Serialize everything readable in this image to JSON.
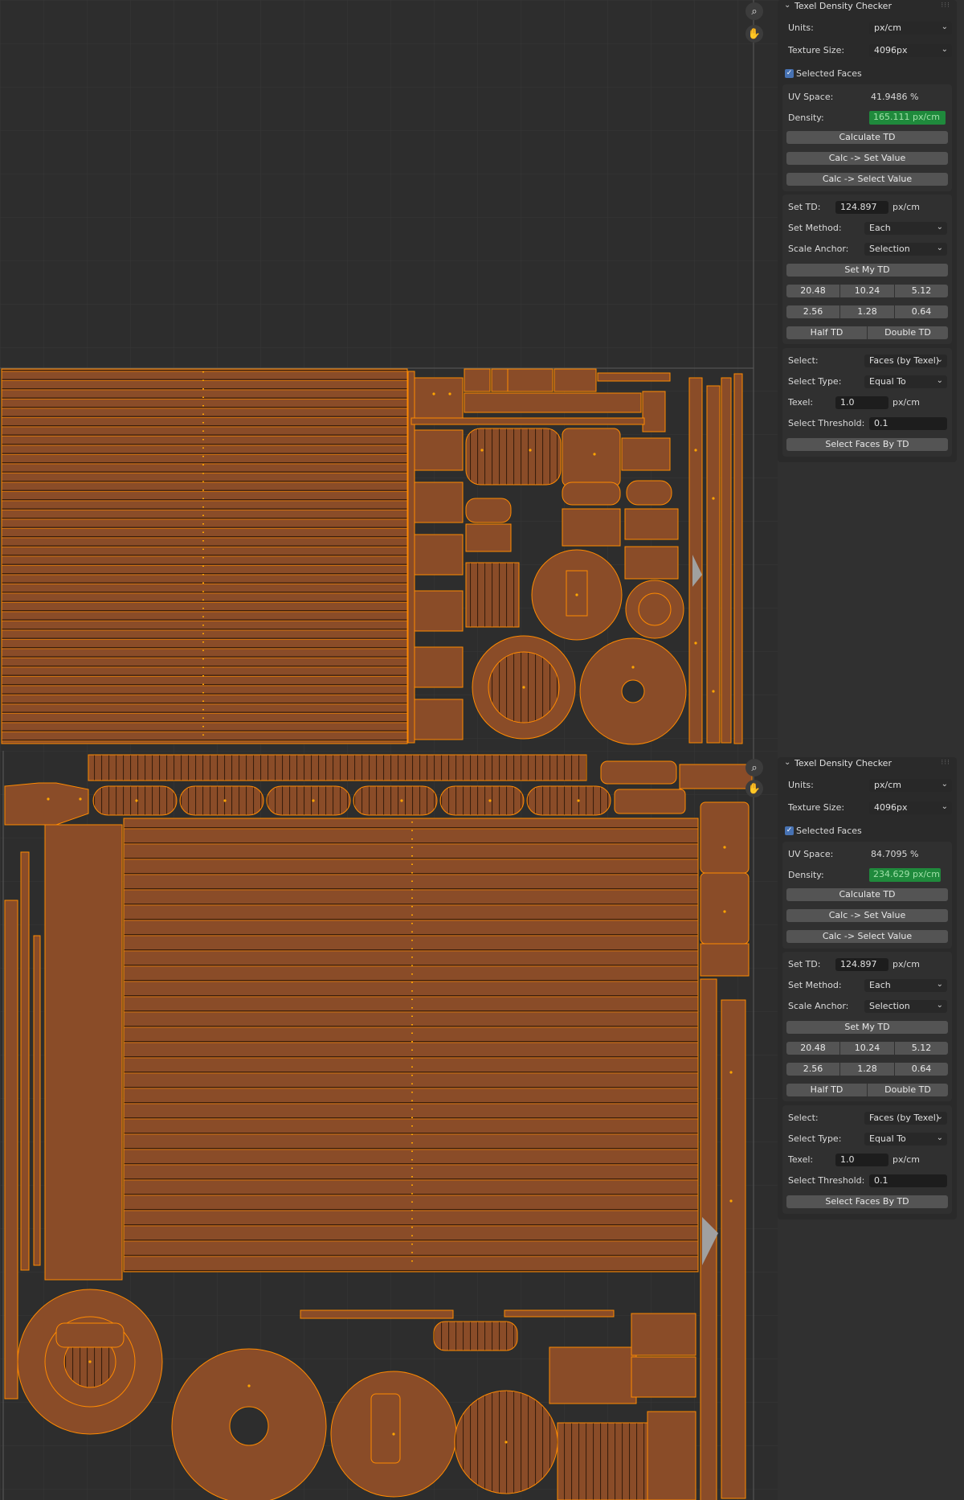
{
  "panels": [
    {
      "title": "Texel Density Checker",
      "units_label": "Units:",
      "units_value": "px/cm",
      "texture_label": "Texture Size:",
      "texture_value": "4096px",
      "selected_faces": "Selected Faces",
      "uv_label": "UV Space:",
      "uv_value": "41.9486 %",
      "density_label": "Density:",
      "density_value": "165.111 px/cm",
      "calc_td": "Calculate TD",
      "calc_set": "Calc -> Set Value",
      "calc_select": "Calc -> Select Value",
      "set_td_label": "Set TD:",
      "set_td_value": "124.897",
      "set_td_unit": "px/cm",
      "method_label": "Set Method:",
      "method_value": "Each",
      "anchor_label": "Scale Anchor:",
      "anchor_value": "Selection",
      "set_my_td": "Set My TD",
      "p1": "20.48",
      "p2": "10.24",
      "p3": "5.12",
      "p4": "2.56",
      "p5": "1.28",
      "p6": "0.64",
      "half_td": "Half TD",
      "double_td": "Double TD",
      "select_label": "Select:",
      "select_value": "Faces (by Texel)",
      "select_type_label": "Select Type:",
      "select_type_value": "Equal To",
      "texel_label": "Texel:",
      "texel_value": "1.0",
      "texel_unit": "px/cm",
      "threshold_label": "Select Threshold:",
      "threshold_value": "0.1",
      "select_faces_btn": "Select Faces By TD"
    },
    {
      "title": "Texel Density Checker",
      "units_label": "Units:",
      "units_value": "px/cm",
      "texture_label": "Texture Size:",
      "texture_value": "4096px",
      "selected_faces": "Selected Faces",
      "uv_label": "UV Space:",
      "uv_value": "84.7095 %",
      "density_label": "Density:",
      "density_value": "234.629 px/cm",
      "calc_td": "Calculate TD",
      "calc_set": "Calc -> Set Value",
      "calc_select": "Calc -> Select Value",
      "set_td_label": "Set TD:",
      "set_td_value": "124.897",
      "set_td_unit": "px/cm",
      "method_label": "Set Method:",
      "method_value": "Each",
      "anchor_label": "Scale Anchor:",
      "anchor_value": "Selection",
      "set_my_td": "Set My TD",
      "p1": "20.48",
      "p2": "10.24",
      "p3": "5.12",
      "p4": "2.56",
      "p5": "1.28",
      "p6": "0.64",
      "half_td": "Half TD",
      "double_td": "Double TD",
      "select_label": "Select:",
      "select_value": "Faces (by Texel)",
      "select_type_label": "Select Type:",
      "select_type_value": "Equal To",
      "texel_label": "Texel:",
      "texel_value": "1.0",
      "texel_unit": "px/cm",
      "threshold_label": "Select Threshold:",
      "threshold_value": "0.1",
      "select_faces_btn": "Select Faces By TD"
    }
  ],
  "nav_icons": {
    "zoom": "zoom-icon",
    "pan": "hand-pan-icon"
  },
  "colors": {
    "uv_fill": "#8a4c28",
    "uv_edge": "#ff8a00",
    "dense_green": "#1f8a3c",
    "checkbox_blue": "#4772b3"
  }
}
